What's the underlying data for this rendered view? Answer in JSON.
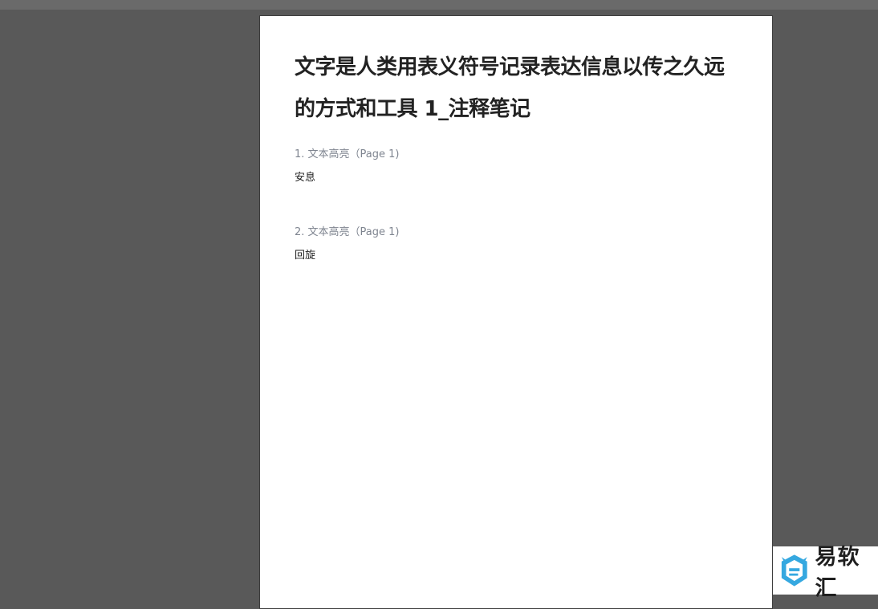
{
  "document": {
    "title": "文字是人类用表义符号记录表达信息以传之久远的方式和工具 1_注释笔记",
    "notes": [
      {
        "header": "1. 文本高亮（Page 1)",
        "text": "安息"
      },
      {
        "header": "2. 文本高亮（Page 1)",
        "text": "回旋"
      }
    ]
  },
  "watermark": {
    "brand": "易软汇",
    "logo_color": "#35a8e0"
  }
}
